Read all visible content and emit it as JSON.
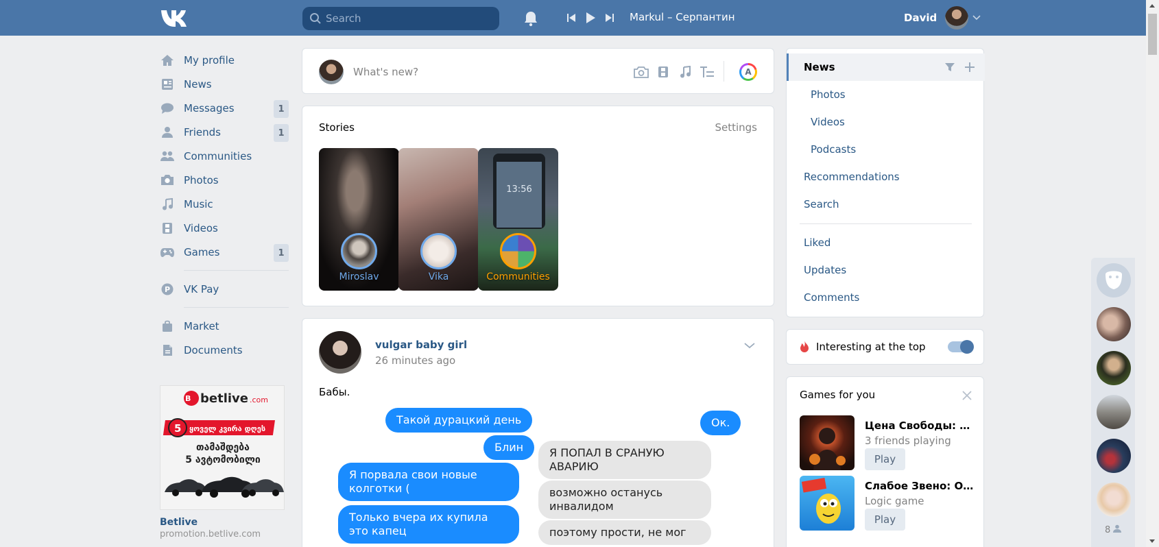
{
  "header": {
    "logo_icon": "vk-logo-icon",
    "search_placeholder": "Search",
    "notifications_icon": "bell-icon",
    "player": {
      "track": "Markul – Серпантин",
      "icons": [
        "prev-icon",
        "play-icon",
        "next-icon"
      ]
    },
    "user": {
      "name": "David"
    }
  },
  "leftnav": {
    "items": [
      {
        "label": "My profile",
        "icon": "home-icon",
        "count": ""
      },
      {
        "label": "News",
        "icon": "news-icon",
        "count": ""
      },
      {
        "label": "Messages",
        "icon": "messages-icon",
        "count": "1"
      },
      {
        "label": "Friends",
        "icon": "friends-icon",
        "count": "1"
      },
      {
        "label": "Communities",
        "icon": "communities-icon",
        "count": ""
      },
      {
        "label": "Photos",
        "icon": "camera-icon",
        "count": ""
      },
      {
        "label": "Music",
        "icon": "music-icon",
        "count": ""
      },
      {
        "label": "Videos",
        "icon": "film-icon",
        "count": ""
      },
      {
        "label": "Games",
        "icon": "gamepad-icon",
        "count": "1"
      }
    ],
    "pay": {
      "label": "VK Pay",
      "icon": "vkpay-icon"
    },
    "extra": [
      {
        "label": "Market",
        "icon": "bag-icon"
      },
      {
        "label": "Documents",
        "icon": "document-icon"
      }
    ],
    "ad": {
      "brand": "betlive",
      "brand_tld": ".com",
      "line1": "ყოველ კვირა დღეს",
      "line2": "თამაშდება",
      "line3": "5 ავტომობილი",
      "title": "Betlive",
      "subtitle": "promotion.betlive.com"
    }
  },
  "composer": {
    "placeholder": "What's new?",
    "avatar_letter": "A"
  },
  "stories": {
    "title": "Stories",
    "settings": "Settings",
    "items": [
      {
        "name": "Miroslav"
      },
      {
        "name": "Vika"
      },
      {
        "name": "Communities"
      }
    ],
    "phone_time": "13:56"
  },
  "post": {
    "author": "vulgar baby girl",
    "time": "26 minutes ago",
    "text": "Бабы.",
    "messages_left": [
      "Такой дурацкий день",
      "Блин",
      "Я порвала свои новые колготки (",
      "Только вчера их купила это капец"
    ],
    "messages_right_sent": "Ок.",
    "messages_right": [
      "Я ПОПАЛ В СРАНУЮ АВАРИЮ",
      "возможно останусь инвалидом",
      "поэтому прости, не мог"
    ]
  },
  "rightmenu": {
    "items": [
      {
        "label": "News",
        "active": true
      },
      {
        "label": "Photos",
        "sub": true
      },
      {
        "label": "Videos",
        "sub": true
      },
      {
        "label": "Podcasts",
        "sub": true
      },
      {
        "label": "Recommendations"
      },
      {
        "label": "Search"
      },
      {
        "label": "Liked"
      },
      {
        "label": "Updates"
      },
      {
        "label": "Comments"
      }
    ],
    "icons": [
      "filter-icon",
      "plus-icon"
    ]
  },
  "interesting": {
    "label": "Interesting at the top",
    "enabled": true
  },
  "games": {
    "title": "Games for you",
    "items": [
      {
        "name": "Цена Свободы: Тайна Гаргульи",
        "sub": "3 friends playing",
        "button": "Play"
      },
      {
        "name": "Слабое Звено: Онлайн",
        "sub": "Logic game",
        "button": "Play"
      }
    ]
  },
  "friends_strip": {
    "online_count": "8"
  },
  "colors": {
    "header": "#4a76a8",
    "link": "#2a5885",
    "background": "#edeef0",
    "story_ring": "#71aaeb",
    "community_ring": "#ffa000",
    "bubble_blue": "#1a8cff"
  }
}
